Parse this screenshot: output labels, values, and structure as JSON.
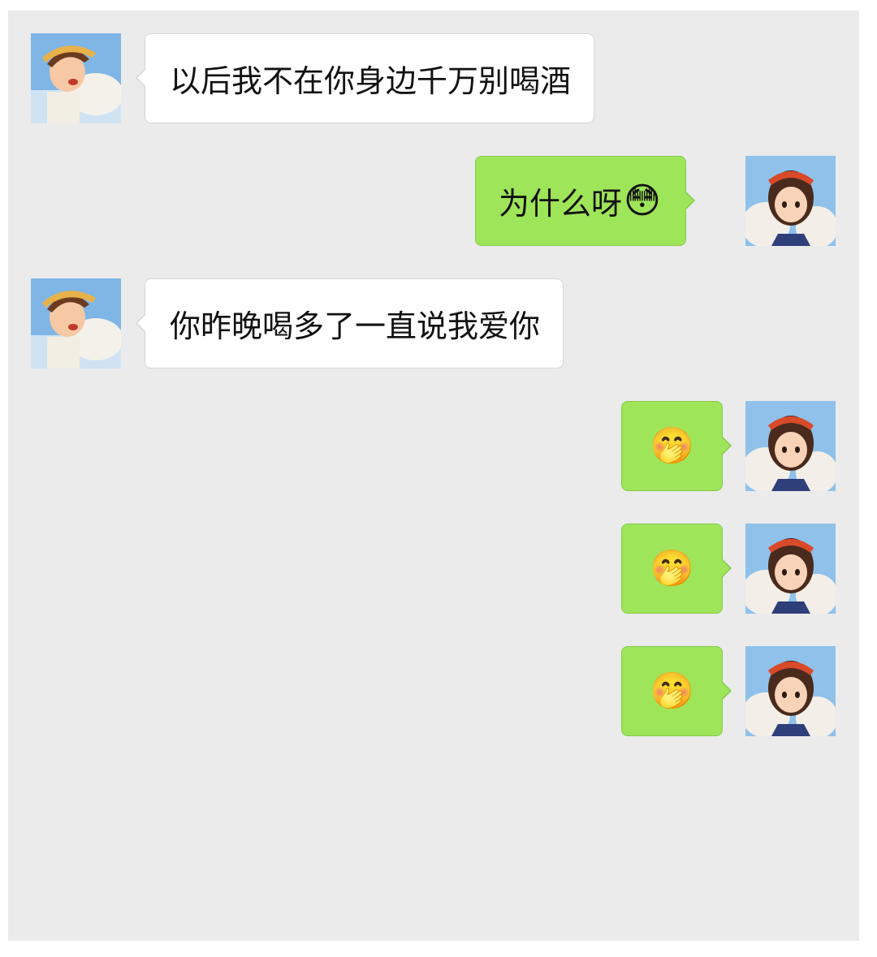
{
  "messages": [
    {
      "side": "left",
      "text": "以后我不在你身边千万别喝酒",
      "emoji": "",
      "avatar": "boy-avatar"
    },
    {
      "side": "right",
      "text": "为什么呀",
      "emoji": "😳",
      "avatar": "girl-avatar"
    },
    {
      "side": "left",
      "text": "你昨晚喝多了一直说我爱你",
      "emoji": "",
      "avatar": "boy-avatar"
    },
    {
      "side": "right",
      "text": "",
      "emoji": "🤭",
      "avatar": "girl-avatar"
    },
    {
      "side": "right",
      "text": "",
      "emoji": "🤭",
      "avatar": "girl-avatar"
    },
    {
      "side": "right",
      "text": "",
      "emoji": "🤭",
      "avatar": "girl-avatar"
    }
  ],
  "colors": {
    "chat_background": "#ebebeb",
    "sent_bubble": "#9ee55a",
    "received_bubble": "#ffffff"
  }
}
